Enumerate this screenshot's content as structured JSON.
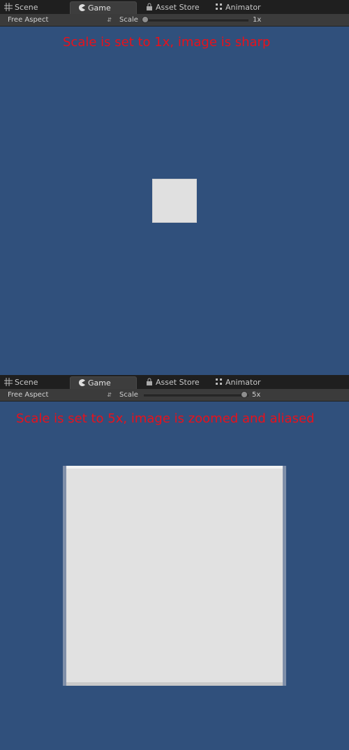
{
  "views": [
    {
      "tabs": {
        "scene": "Scene",
        "game": "Game",
        "asset_store": "Asset Store",
        "animator": "Animator"
      },
      "toolbar": {
        "aspect": "Free Aspect",
        "scale_label": "Scale",
        "scale_value": "1x",
        "scale_fraction": 0.0
      },
      "caption": "Scale is set to 1x, image is sharp"
    },
    {
      "tabs": {
        "scene": "Scene",
        "game": "Game",
        "asset_store": "Asset Store",
        "animator": "Animator"
      },
      "toolbar": {
        "aspect": "Free Aspect",
        "scale_label": "Scale",
        "scale_value": "5x",
        "scale_fraction": 1.0
      },
      "caption": "Scale is set to 5x, image is zoomed and aliased"
    }
  ],
  "colors": {
    "background": "#30507c",
    "caption": "#e8111b",
    "square": "#e0e0e0"
  },
  "icons": {
    "scene": "grid-icon",
    "game": "pacman-icon",
    "asset_store": "lock-icon",
    "animator": "animator-icon"
  }
}
